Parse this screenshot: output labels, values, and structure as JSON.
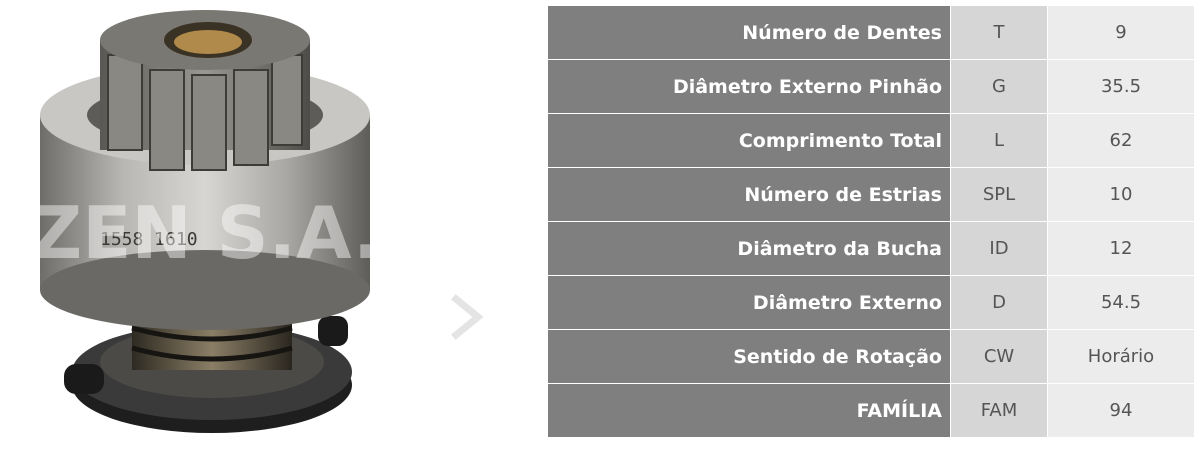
{
  "product": {
    "image_label": "starter-drive-pinion",
    "watermark": "ZEN S.A.",
    "stamp": "1558  1610"
  },
  "specs": [
    {
      "label": "Número de Dentes",
      "code": "T",
      "value": "9"
    },
    {
      "label": "Diâmetro Externo Pinhão",
      "code": "G",
      "value": "35.5"
    },
    {
      "label": "Comprimento Total",
      "code": "L",
      "value": "62"
    },
    {
      "label": "Número de Estrias",
      "code": "SPL",
      "value": "10"
    },
    {
      "label": "Diâmetro da Bucha",
      "code": "ID",
      "value": "12"
    },
    {
      "label": "Diâmetro Externo",
      "code": "D",
      "value": "54.5"
    },
    {
      "label": "Sentido de Rotação",
      "code": "CW",
      "value": "Horário"
    },
    {
      "label": "FAMÍLIA",
      "code": "FAM",
      "value": "94"
    }
  ],
  "colors": {
    "label_bg": "#7f7f7f",
    "code_bg": "#d6d6d6",
    "value_bg": "#ececec"
  }
}
